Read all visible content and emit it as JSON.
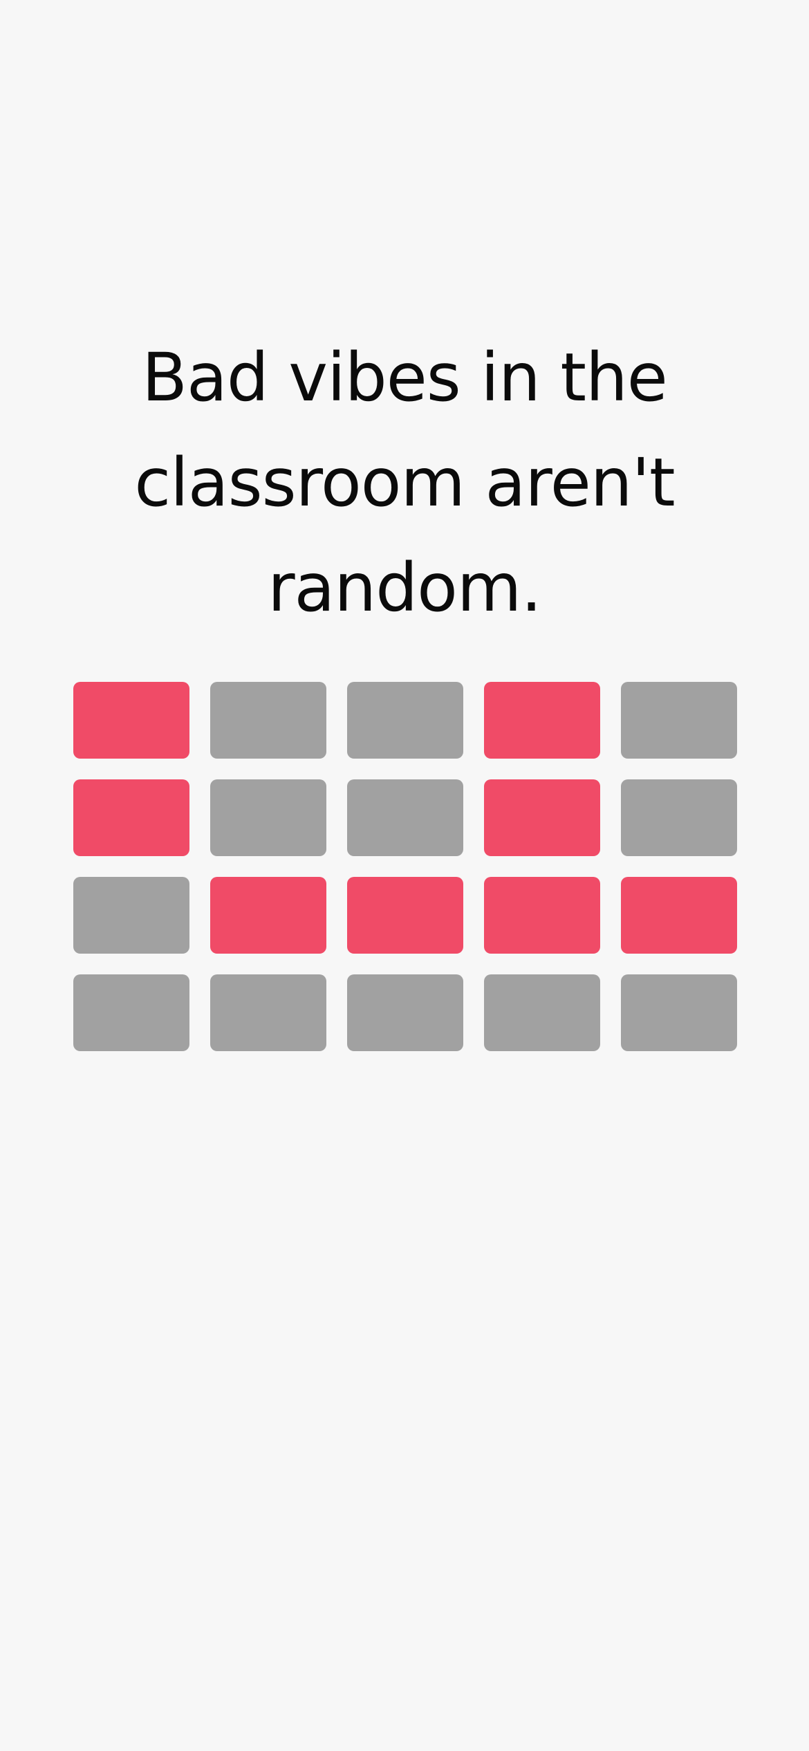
{
  "headline": {
    "text": "Bad vibes in the classroom aren't random."
  },
  "colors": {
    "background": "#f7f7f7",
    "highlight": "#f04b67",
    "neutral": "#a1a1a1",
    "text": "#0b0b0b"
  },
  "grid": {
    "rows": [
      [
        "highlight",
        "neutral",
        "neutral",
        "highlight",
        "neutral"
      ],
      [
        "highlight",
        "neutral",
        "neutral",
        "highlight",
        "neutral"
      ],
      [
        "neutral",
        "highlight",
        "highlight",
        "highlight",
        "highlight"
      ],
      [
        "neutral",
        "neutral",
        "neutral",
        "neutral",
        "neutral"
      ]
    ]
  }
}
